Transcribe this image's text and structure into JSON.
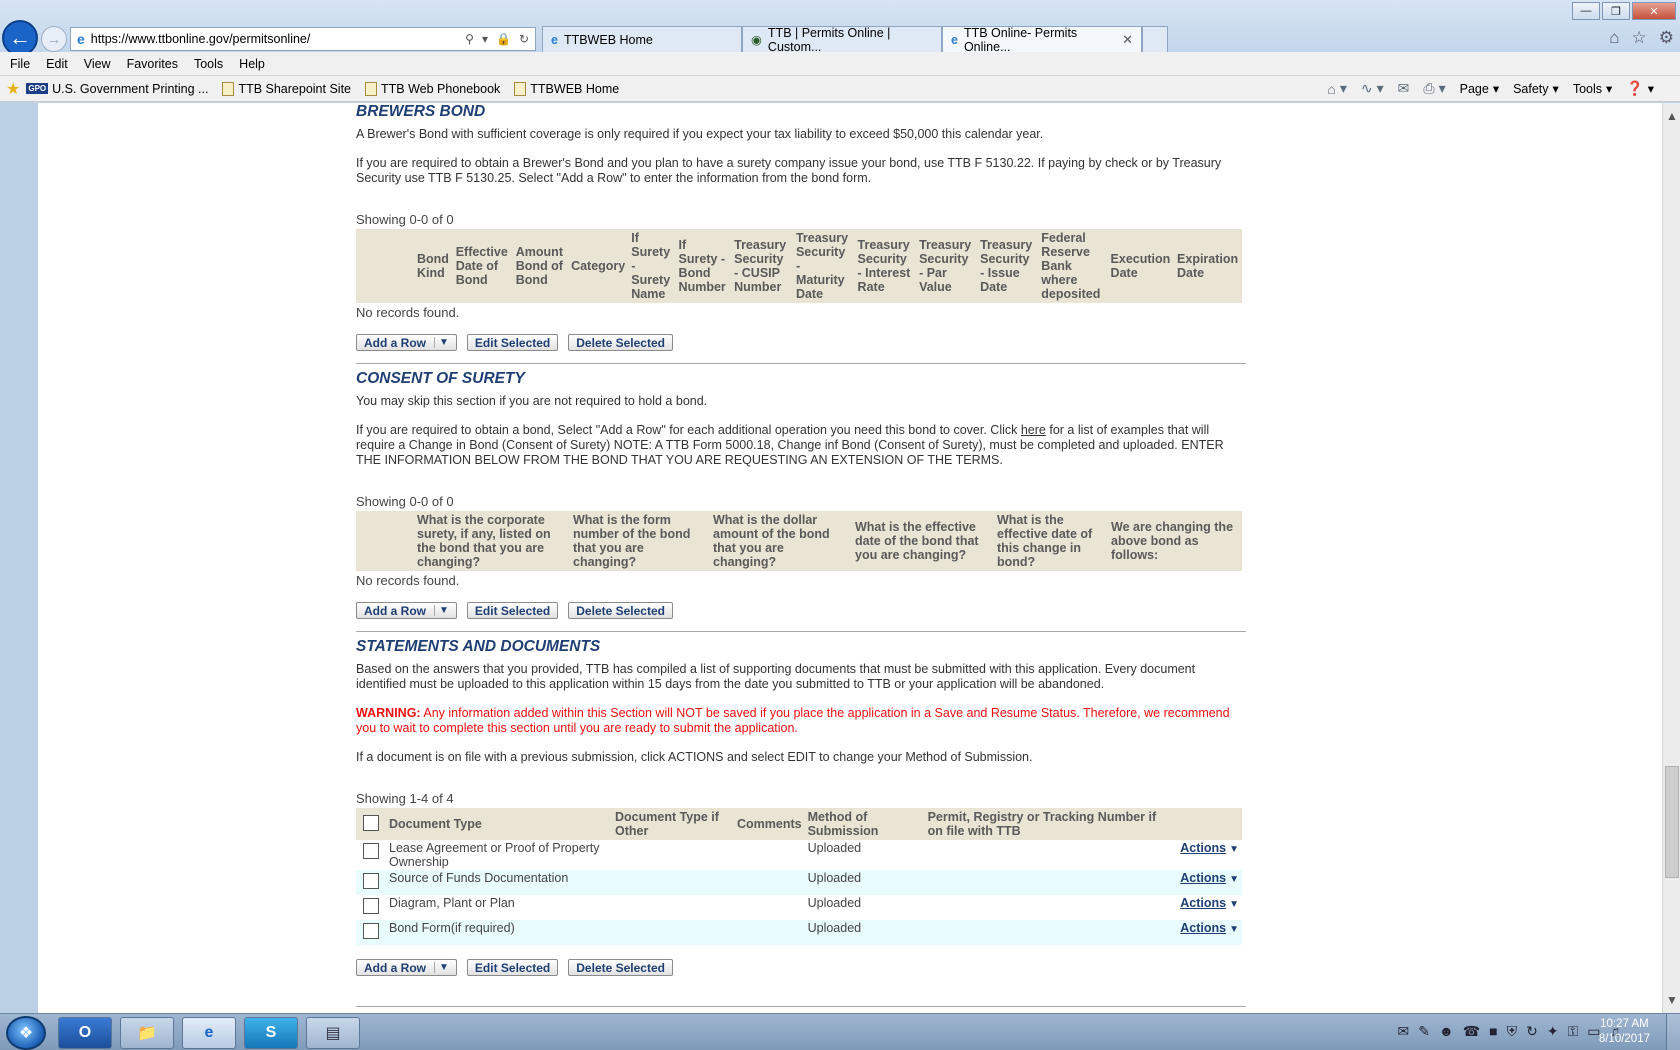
{
  "browser": {
    "url": "https://www.ttbonline.gov/permitsonline/",
    "tabs": [
      {
        "label": "TTBWEB Home"
      },
      {
        "label": "TTB | Permits Online | Custom..."
      },
      {
        "label": "TTB Online- Permits Online..."
      }
    ],
    "menu": [
      "File",
      "Edit",
      "View",
      "Favorites",
      "Tools",
      "Help"
    ],
    "favorites": [
      {
        "label": "U.S. Government Printing ..."
      },
      {
        "label": "TTB Sharepoint Site"
      },
      {
        "label": "TTB Web Phonebook"
      },
      {
        "label": "TTBWEB Home"
      }
    ],
    "commands": {
      "page": "Page",
      "safety": "Safety",
      "tools": "Tools"
    }
  },
  "brewers_bond": {
    "title": "BREWERS BOND",
    "para1": "A Brewer's Bond with sufficient coverage is only required if you expect your tax liability to exceed $50,000 this calendar year.",
    "para2": "If you are required to obtain a Brewer's Bond and you plan to have a surety company issue your bond, use TTB F 5130.22. If paying by check or by Treasury Security use TTB F 5130.25. Select \"Add a Row\" to enter the information from the bond form.",
    "showing": "Showing 0-0 of 0",
    "columns": [
      "Bond Kind",
      "Effective Date of Bond",
      "Amount Bond of Bond",
      "Category",
      "If Surety - Surety Name",
      "If Surety - Bond Number",
      "Treasury Security - CUSIP Number",
      "Treasury Security - Maturity Date",
      "Treasury Security - Interest Rate",
      "Treasury Security - Par Value",
      "Treasury Security - Issue Date",
      "Federal Reserve Bank where deposited",
      "Execution Date",
      "Expiration Date"
    ],
    "no_records": "No records found."
  },
  "consent_of_surety": {
    "title": "CONSENT OF SURETY",
    "para1": "You may skip this section if you are not required to hold a bond.",
    "para2_before_link": "If you are required to obtain a bond, Select \"Add a Row\" for each additional operation you need this bond to cover. Click ",
    "link": "here",
    "para2_after_link": " for a list of examples that will require a Change in Bond (Consent of Surety) NOTE: A TTB Form 5000.18, Change inf Bond (Consent of Surety), must be completed and uploaded. ENTER THE INFORMATION BELOW FROM THE BOND THAT YOU ARE REQUESTING AN EXTENSION OF THE TERMS.",
    "showing": "Showing 0-0 of 0",
    "columns": [
      "What is the corporate surety, if any, listed on the bond that you are changing?",
      "What is the form number of the bond that you are changing?",
      "What is the dollar amount of the bond that you are changing?",
      "What is the effective date of the bond that you are changing?",
      "What is the effective date of this change in bond?",
      "We are changing the above bond as follows:"
    ],
    "no_records": "No records found."
  },
  "statements": {
    "title": "STATEMENTS AND DOCUMENTS",
    "para1": "Based on the answers that you provided, TTB has compiled a list of supporting documents that must be submitted with this application. Every document identified must be uploaded to this application within 15 days from the date you submitted to TTB or your application will be abandoned.",
    "warning_label": "WARNING:",
    "warning_text": " Any information added within this Section will NOT be saved if you place the application in a Save and Resume Status. Therefore, we recommend you to wait to complete this section until you are ready to submit the application.",
    "para3": "If a document is on file with a previous submission, click ACTIONS and select EDIT to change your Method of Submission.",
    "showing": "Showing 1-4 of 4",
    "columns": [
      "Document Type",
      "Document Type if Other",
      "Comments",
      "Method of Submission",
      "Permit, Registry or Tracking Number if on file with TTB"
    ],
    "rows": [
      {
        "doc_type": "Lease Agreement or Proof of Property Ownership",
        "other": "",
        "comments": "",
        "method": "Uploaded",
        "number": "",
        "actions": "Actions"
      },
      {
        "doc_type": "Source of Funds Documentation",
        "other": "",
        "comments": "",
        "method": "Uploaded",
        "number": "",
        "actions": "Actions"
      },
      {
        "doc_type": "Diagram, Plant or Plan",
        "other": "",
        "comments": "",
        "method": "Uploaded",
        "number": "",
        "actions": "Actions"
      },
      {
        "doc_type": "Bond Form(if required)",
        "other": "",
        "comments": "",
        "method": "Uploaded",
        "number": "",
        "actions": "Actions"
      }
    ]
  },
  "buttons": {
    "add_row": "Add a Row",
    "edit_selected": "Edit Selected",
    "delete_selected": "Delete Selected"
  },
  "taskbar": {
    "time": "10:27 AM",
    "date": "8/10/2017"
  }
}
